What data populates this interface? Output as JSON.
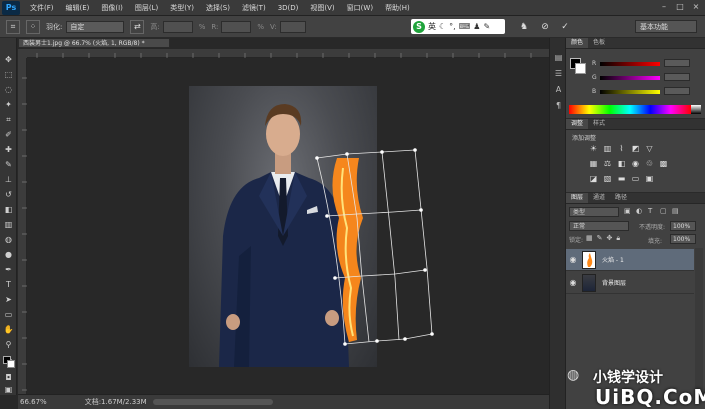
{
  "app": {
    "logo": "Ps",
    "menu": [
      "文件(F)",
      "编辑(E)",
      "图像(I)",
      "图层(L)",
      "类型(Y)",
      "选择(S)",
      "滤镜(T)",
      "3D(D)",
      "视图(V)",
      "窗口(W)",
      "帮助(H)"
    ]
  },
  "options": {
    "feather_label": "羽化:",
    "mode_value": "自定",
    "f1": "R:",
    "f2": "高:",
    "f3": "%",
    "f4": "宽:",
    "f5": "%",
    "f6": "V:",
    "workspace": "基本功能"
  },
  "ime": {
    "logo": "S",
    "label": "英"
  },
  "document": {
    "tab": "西装男士1.jpg @ 66.7% (火焰, 1, RGB/8) *",
    "zoom": "66.67%",
    "doc_info": "文档:1.67M/2.33M"
  },
  "color_panel": {
    "tabs": [
      "颜色",
      "色板"
    ],
    "r_label": "R",
    "g_label": "G",
    "b_label": "B"
  },
  "adjust_panel": {
    "tabs": [
      "调整",
      "样式"
    ],
    "title": "添加调整"
  },
  "layers_panel": {
    "tabs": [
      "图层",
      "通道",
      "路径"
    ],
    "filter": "类型",
    "blend": "正常",
    "opacity_label": "不透明度:",
    "opacity": "100%",
    "lock_label": "锁定:",
    "fill_label": "填充:",
    "fill": "100%",
    "layers": [
      {
        "name": "火焰 - 1",
        "selected": true
      },
      {
        "name": "背景图层",
        "selected": false
      }
    ]
  },
  "watermark": {
    "title": "小钱学设计",
    "site": "UiBQ.CoM"
  },
  "colors": {
    "accent": "#31a8ff",
    "selected_layer": "#5f6b7a",
    "fire": "#ff8a1a"
  }
}
